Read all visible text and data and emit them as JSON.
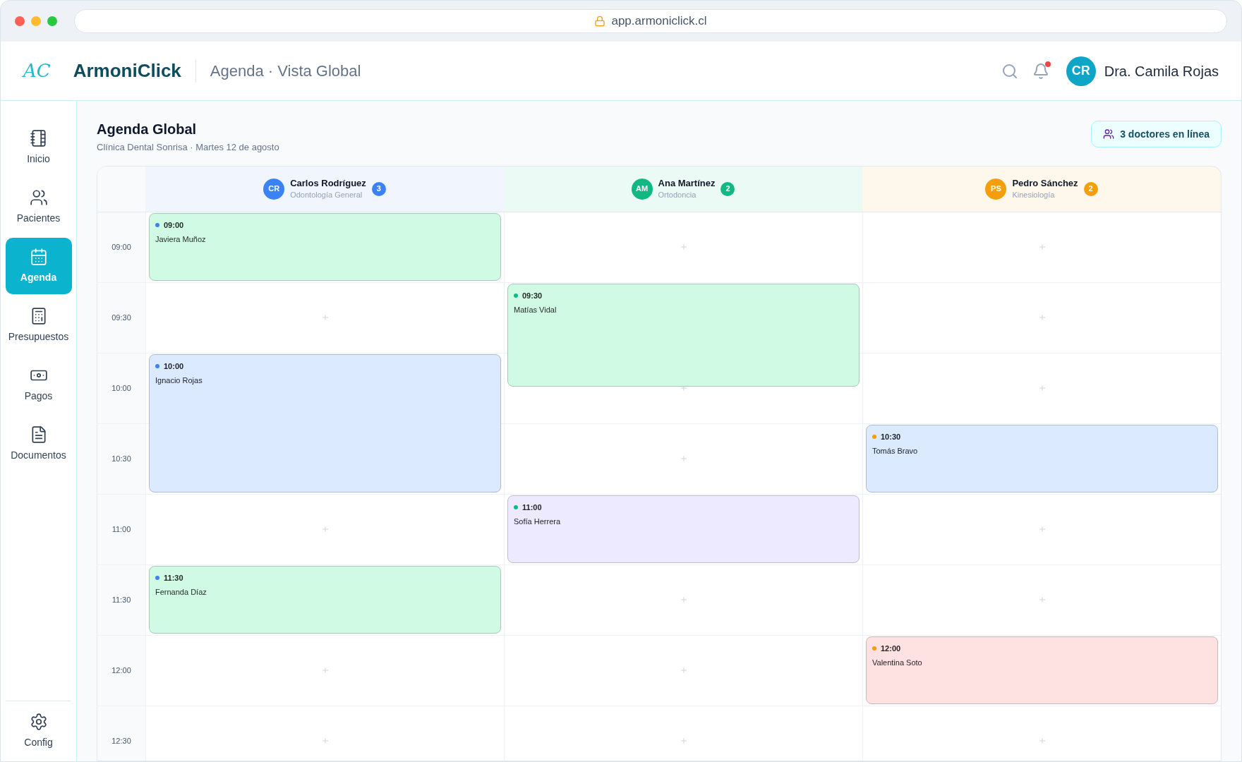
{
  "browser": {
    "url": "app.armoniclick.cl"
  },
  "header": {
    "logo_mark": "AC",
    "brand": "ArmoniClick",
    "page_title": "Agenda · Vista Global",
    "notifications": true,
    "user": {
      "initials": "CR",
      "name": "Dra. Camila Rojas"
    }
  },
  "sidebar": {
    "items": [
      {
        "label": "Inicio",
        "selected": false
      },
      {
        "label": "Pacientes",
        "selected": false
      },
      {
        "label": "Agenda",
        "selected": true
      },
      {
        "label": "Presupuestos",
        "selected": false
      },
      {
        "label": "Pagos",
        "selected": false
      },
      {
        "label": "Documentos",
        "selected": false
      }
    ],
    "footer": {
      "label": "Config"
    }
  },
  "main": {
    "title": "Agenda Global",
    "subtitle": "Clínica Dental Sonrisa · Martes 12 de agosto",
    "online_badge": "3 doctores en línea"
  },
  "doctors": [
    {
      "initials": "CR",
      "name": "Carlos Rodríguez",
      "specialty": "Odontología General",
      "count": "3",
      "color": "#3b82f6"
    },
    {
      "initials": "AM",
      "name": "Ana Martínez",
      "specialty": "Ortodoncia",
      "count": "2",
      "color": "#10b981"
    },
    {
      "initials": "PS",
      "name": "Pedro Sánchez",
      "specialty": "Kinesiología",
      "count": "2",
      "color": "#f59e0b"
    }
  ],
  "rows": [
    {
      "time": "09:00",
      "cells": [
        {
          "kind": "appointment",
          "time": "09:00",
          "patient": "Javiera Muñoz",
          "color": "#d1fae5"
        },
        {
          "kind": "empty"
        },
        {
          "kind": "empty"
        }
      ]
    },
    {
      "time": "09:30",
      "cells": [
        {
          "kind": "empty"
        },
        {
          "kind": "appointment",
          "time": "09:30",
          "patient": "Matías Vidal",
          "color": "#d1fae5"
        },
        {
          "kind": "empty"
        }
      ]
    },
    {
      "time": "10:00",
      "cells": [
        {
          "kind": "appointment",
          "time": "10:00",
          "patient": "Ignacio Rojas",
          "color": "#dbeafe"
        },
        {
          "kind": "half_covered"
        },
        {
          "kind": "empty"
        }
      ]
    },
    {
      "time": "10:30",
      "cells": [
        {
          "kind": "covered"
        },
        {
          "kind": "empty"
        },
        {
          "kind": "appointment",
          "time": "10:30",
          "patient": "Tomás Bravo",
          "color": "#dbeafe"
        }
      ]
    },
    {
      "time": "11:00",
      "cells": [
        {
          "kind": "empty"
        },
        {
          "kind": "appointment",
          "time": "11:00",
          "patient": "Sofía Herrera",
          "color": "#ede9fe"
        },
        {
          "kind": "empty"
        }
      ]
    },
    {
      "time": "11:30",
      "cells": [
        {
          "kind": "appointment",
          "time": "11:30",
          "patient": "Fernanda Díaz",
          "color": "#d1fae5"
        },
        {
          "kind": "empty"
        },
        {
          "kind": "empty"
        }
      ]
    },
    {
      "time": "12:00",
      "cells": [
        {
          "kind": "empty"
        },
        {
          "kind": "empty"
        },
        {
          "kind": "appointment",
          "time": "12:00",
          "patient": "Valentina Soto",
          "color": "#fee2e2"
        }
      ]
    },
    {
      "time": "12:30",
      "cells": [
        {
          "kind": "empty"
        },
        {
          "kind": "empty"
        },
        {
          "kind": "empty"
        }
      ]
    }
  ]
}
